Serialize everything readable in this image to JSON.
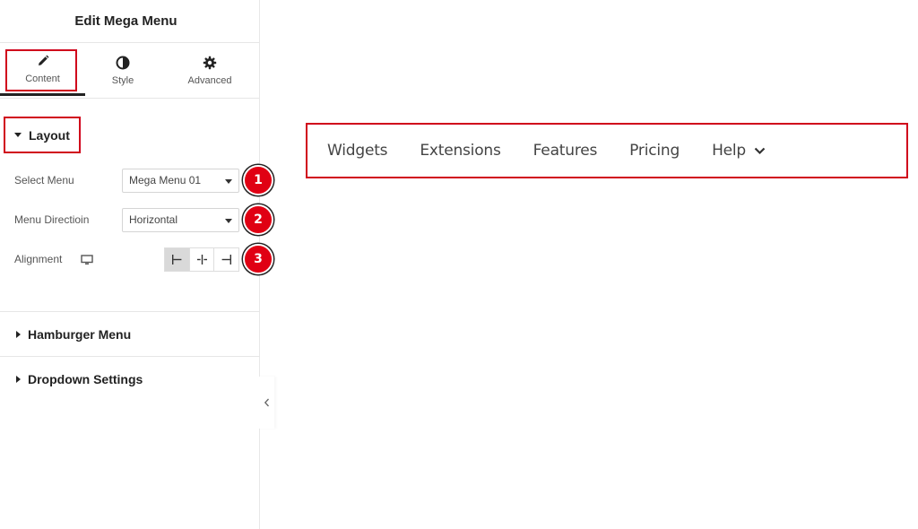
{
  "panel": {
    "title": "Edit Mega Menu",
    "tabs": [
      {
        "label": "Content",
        "icon": "pencil-icon"
      },
      {
        "label": "Style",
        "icon": "contrast-icon"
      },
      {
        "label": "Advanced",
        "icon": "gear-icon"
      }
    ],
    "active_tab": "Content"
  },
  "layout": {
    "title": "Layout",
    "select_menu": {
      "label": "Select Menu",
      "value": "Mega Menu 01",
      "badge": "1"
    },
    "menu_direction": {
      "label": "Menu Directioin",
      "value": "Horizontal",
      "badge": "2"
    },
    "alignment": {
      "label": "Alignment",
      "device_icon": "monitor-icon",
      "badge": "3",
      "options": [
        "align-left-icon",
        "align-center-icon",
        "align-right-icon"
      ],
      "active": "align-left-icon"
    }
  },
  "sections": {
    "hamburger": "Hamburger Menu",
    "dropdown": "Dropdown Settings"
  },
  "preview": {
    "menu_items": [
      "Widgets",
      "Extensions",
      "Features",
      "Pricing",
      "Help"
    ]
  },
  "colors": {
    "highlight": "#d0021b",
    "badge": "#e00013"
  }
}
